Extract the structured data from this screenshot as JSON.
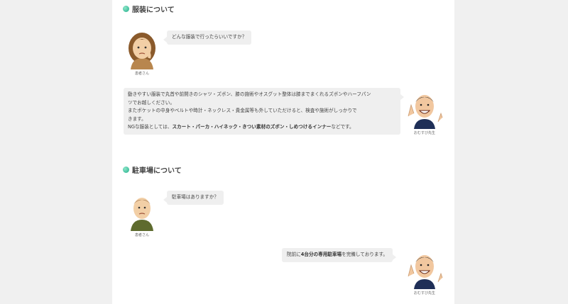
{
  "sections": [
    {
      "heading": "服装について",
      "question": {
        "speaker": "患者さん",
        "text": "どんな服装で行ったらいいですか？"
      },
      "answer": {
        "speaker": "おむすび先生",
        "line1": "動きやすい服装で丸首や前開きのシャツ・ズボン、膝の施術やオスグット整体は膝までまくれるズボンやハーフパン",
        "line2": "ツでお越しください。",
        "line3": "またポケットの中身やベルトや時計・ネックレス・貴金属等も外していただけると、検査や施術がしっかりで",
        "line4": "きます。",
        "line5_prefix": "NGな服装としては、",
        "line5_bold": "スカート・パーカ・ハイネック・きつい素材のズボン・しめつけるインナー",
        "line5_suffix": "などです。"
      }
    },
    {
      "heading": "駐車場について",
      "question": {
        "speaker": "患者さん",
        "text": "駐車場はありますか？"
      },
      "answer": {
        "speaker": "おむすび先生",
        "prefix": "院前に",
        "bold": "4台分の専用駐車場",
        "suffix": "を完備しております。"
      }
    }
  ],
  "colors": {
    "page_bg": "#f0f0f0",
    "content_bg": "#ffffff",
    "bubble_bg": "#efefef",
    "heading_dot": "#1fae8a"
  }
}
